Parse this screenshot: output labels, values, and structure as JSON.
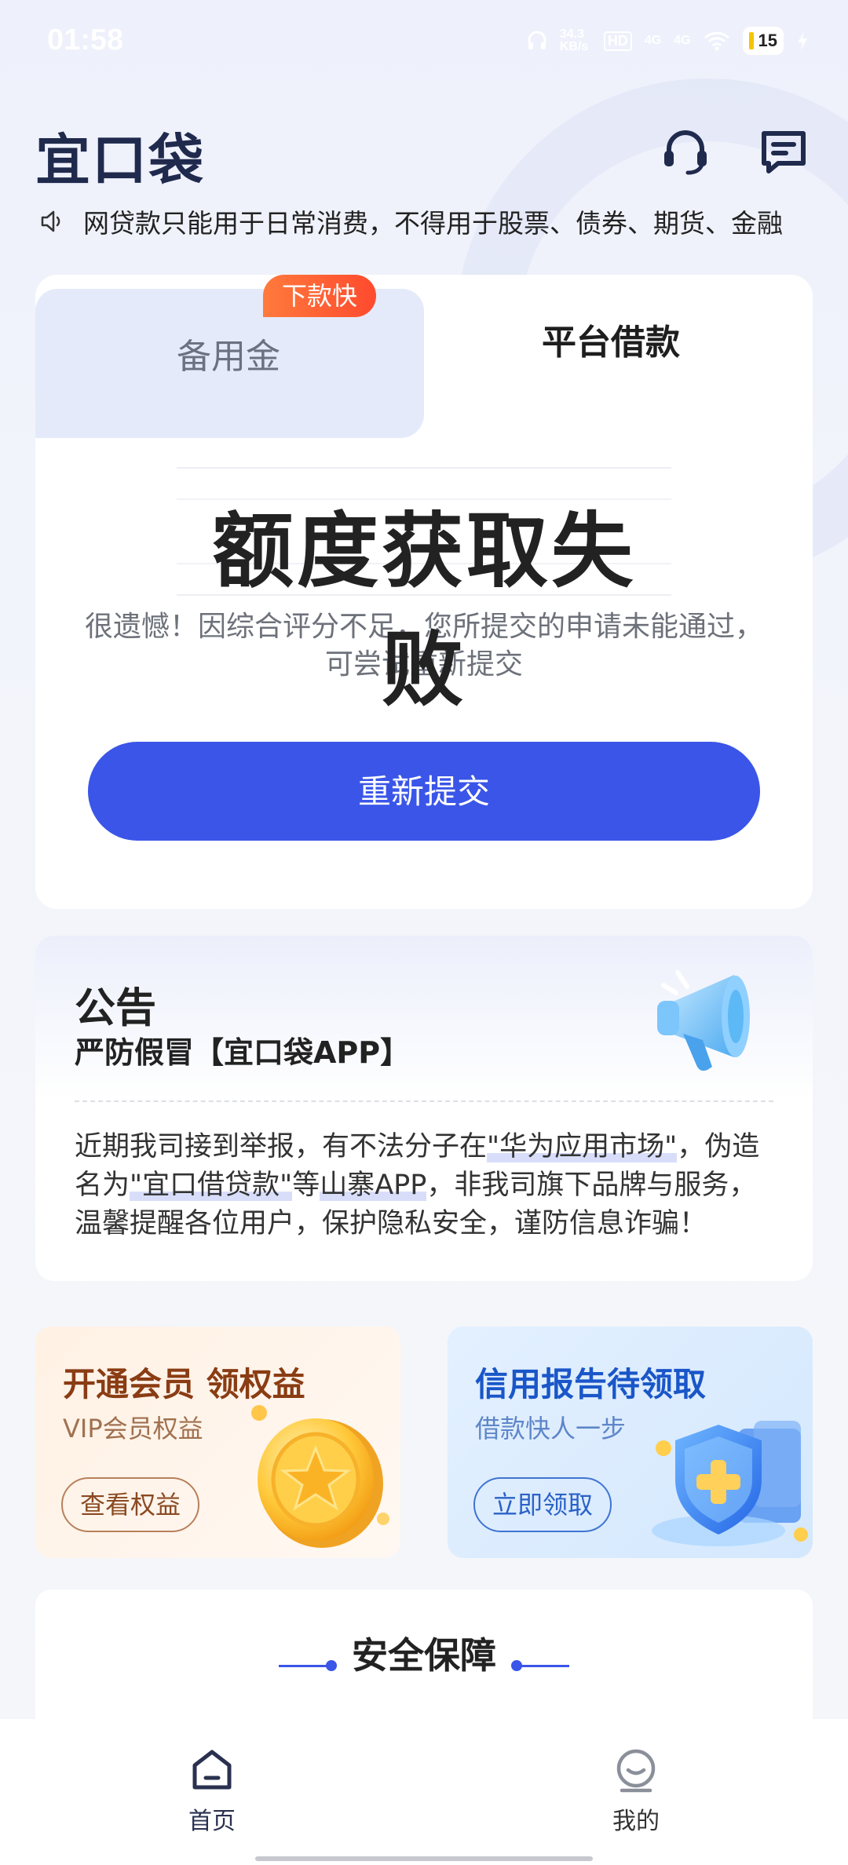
{
  "status_bar": {
    "time": "01:58",
    "network_speed": "34.3 KB/s",
    "hd": "HD",
    "signal1": "4G",
    "signal2": "4G",
    "battery": "15"
  },
  "header": {
    "logo": "宜口袋",
    "headset_icon": "headset-icon",
    "message_icon": "message-icon"
  },
  "notice": {
    "text": "网贷款只能用于日常消费，不得用于股票、债券、期货、金融"
  },
  "loan_card": {
    "tabs": [
      {
        "label": "备用金",
        "badge": "下款快",
        "active": false
      },
      {
        "label": "平台借款",
        "active": true
      }
    ],
    "result_title": "额度获取失败",
    "result_desc": "很遗憾！因综合评分不足，您所提交的申请未能通过，可尝试重新提交",
    "resubmit_label": "重新提交"
  },
  "announcement": {
    "title": "公告",
    "subtitle": "严防假冒【宜口袋APP】",
    "body_parts": {
      "p1": "近期我司接到举报，有不法分子在",
      "h1": "\"华为应用市场\"",
      "p2": "，伪造名为",
      "h2": "\"宜口借贷款\"",
      "p3": "等",
      "h3": "山寨APP",
      "p4": "，非我司旗下品牌与服务，温馨提醒各位用户，保护隐私安全，谨防信息诈骗！"
    }
  },
  "promos": {
    "vip": {
      "title": "开通会员 领权益",
      "subtitle": "VIP会员权益",
      "button": "查看权益"
    },
    "credit": {
      "title": "信用报告待领取",
      "subtitle": "借款快人一步",
      "button": "立即领取"
    }
  },
  "security": {
    "title": "安全保障"
  },
  "bottom_nav": {
    "items": [
      {
        "label": "首页",
        "icon": "home-icon",
        "active": true
      },
      {
        "label": "我的",
        "icon": "profile-icon",
        "active": false
      }
    ]
  },
  "colors": {
    "primary": "#3a55e8",
    "badge": "#ff5a33",
    "vip_text": "#8a3c13",
    "credit_text": "#1a56c8"
  }
}
